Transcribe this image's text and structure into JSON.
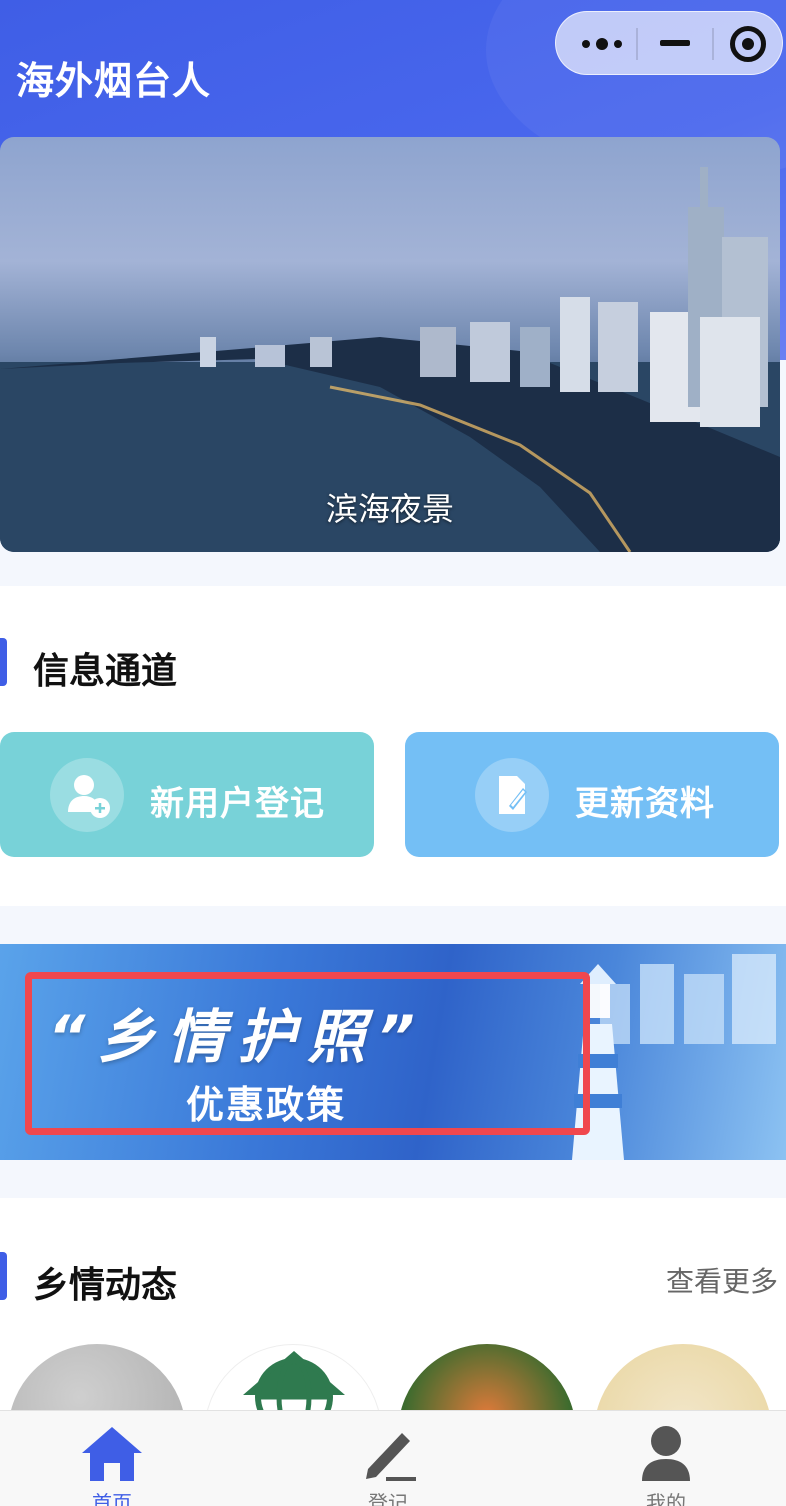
{
  "header": {
    "title": "海外烟台人"
  },
  "capsule": {
    "more": "more-menu",
    "minimize": "minimize",
    "close": "close-miniprogram"
  },
  "banner": {
    "caption": "滨海夜景"
  },
  "info_channel": {
    "title": "信息通道",
    "tiles": [
      {
        "label": "新用户登记",
        "icon": "add-user-icon",
        "color": "#78d2d8"
      },
      {
        "label": "更新资料",
        "icon": "edit-document-icon",
        "color": "#74bff5"
      }
    ]
  },
  "promo": {
    "title": "“乡情护照”",
    "subtitle": "优惠政策",
    "highlight_color": "#f0474e"
  },
  "news": {
    "title": "乡情动态",
    "more_label": "查看更多"
  },
  "tabbar": {
    "items": [
      {
        "label": "首页",
        "icon": "home-icon",
        "active": true
      },
      {
        "label": "登记",
        "icon": "pencil-icon",
        "active": false
      },
      {
        "label": "我的",
        "icon": "user-icon",
        "active": false
      }
    ],
    "active_color": "#3f5ee6"
  },
  "colors": {
    "accent": "#3f5ee6",
    "header_bg": "#4a68ee"
  }
}
